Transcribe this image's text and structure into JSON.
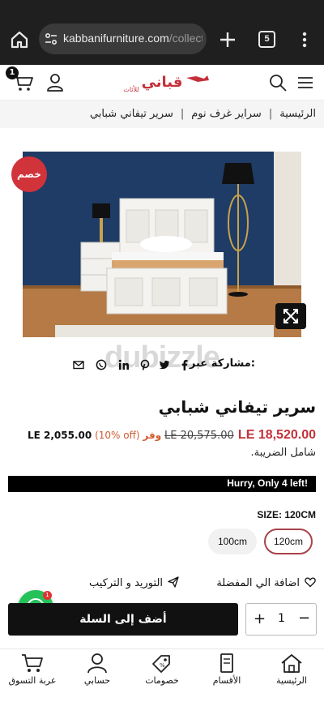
{
  "browser": {
    "url_main": "kabbanifurniture.com",
    "url_rest": "/collecti",
    "tab_count": "5"
  },
  "header": {
    "cart_count": "1",
    "logo_text": "قباني",
    "logo_sub": "للأثاث"
  },
  "breadcrumb": {
    "home": "الرئيسية",
    "category": "سراير غرف نوم",
    "current": "سرير تيفاني شبابي"
  },
  "product": {
    "sale_badge": "خصم",
    "share_label": "مشاركة عبر:",
    "title": "سرير تيفاني شبابي",
    "price": "LE 18,520.00",
    "compare_price": "LE 20,575.00",
    "save_word": "وفر",
    "save_percent": "(10% off)",
    "save_amount": "LE 2,055.00",
    "tax_note": "شامل الضريبة.",
    "stock_banner": "Hurry, Only 4 left!",
    "size_label": "SIZE: 120CM",
    "sizes": [
      "120cm",
      "100cm"
    ],
    "selected_size": "120cm",
    "wishlist_label": "اضافة الي المفضلة",
    "shipping_label": "التوريد و التركيب",
    "add_to_cart": "أضف إلى السلة",
    "quantity": "1",
    "qty_plus": "+",
    "qty_minus": "−"
  },
  "whatsapp": {
    "badge": "1"
  },
  "watermark": "dubizzle",
  "bottom_nav": {
    "home": "الرئيسية",
    "categories": "الأقسام",
    "discounts": "خصومات",
    "account": "حسابي",
    "cart": "عربة التسوق"
  },
  "colors": {
    "brand_red": "#c4313a",
    "sale_badge": "#d1333b",
    "whatsapp": "#25c25a",
    "chrome_bg": "#1f1f1f"
  }
}
